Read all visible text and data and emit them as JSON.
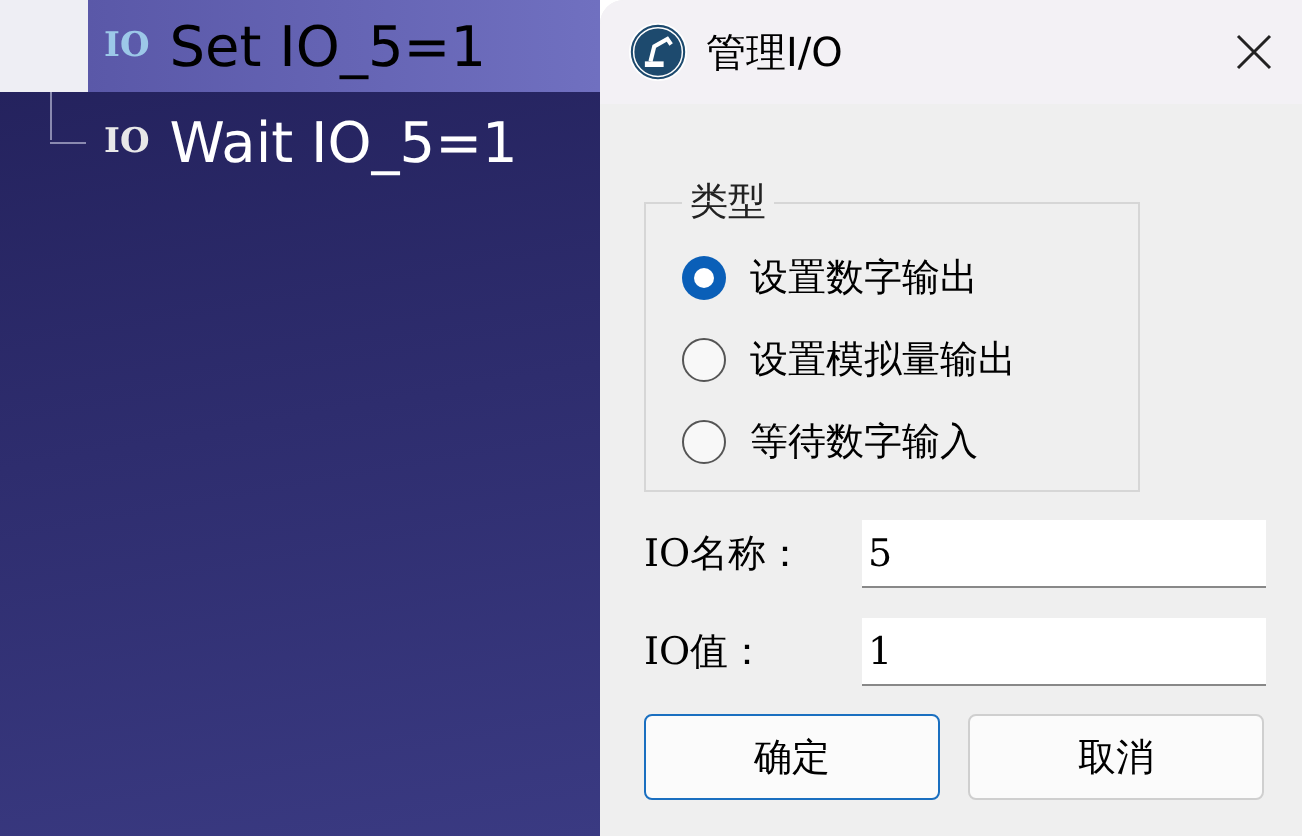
{
  "tree": {
    "items": [
      {
        "icon_text": "IO",
        "label": "Set IO_5=1",
        "selected": true
      },
      {
        "icon_text": "IO",
        "label": "Wait IO_5=1",
        "selected": false
      }
    ]
  },
  "dialog": {
    "title": "管理I/O",
    "group": {
      "title": "类型",
      "options": [
        {
          "label": "设置数字输出",
          "selected": true
        },
        {
          "label": "设置模拟量输出",
          "selected": false
        },
        {
          "label": "等待数字输入",
          "selected": false
        }
      ]
    },
    "fields": [
      {
        "label": "IO名称：",
        "value": "5"
      },
      {
        "label": "IO值：",
        "value": "1"
      }
    ],
    "buttons": [
      {
        "label": "确定",
        "kind": "primary"
      },
      {
        "label": "取消",
        "kind": "secondary"
      }
    ]
  }
}
